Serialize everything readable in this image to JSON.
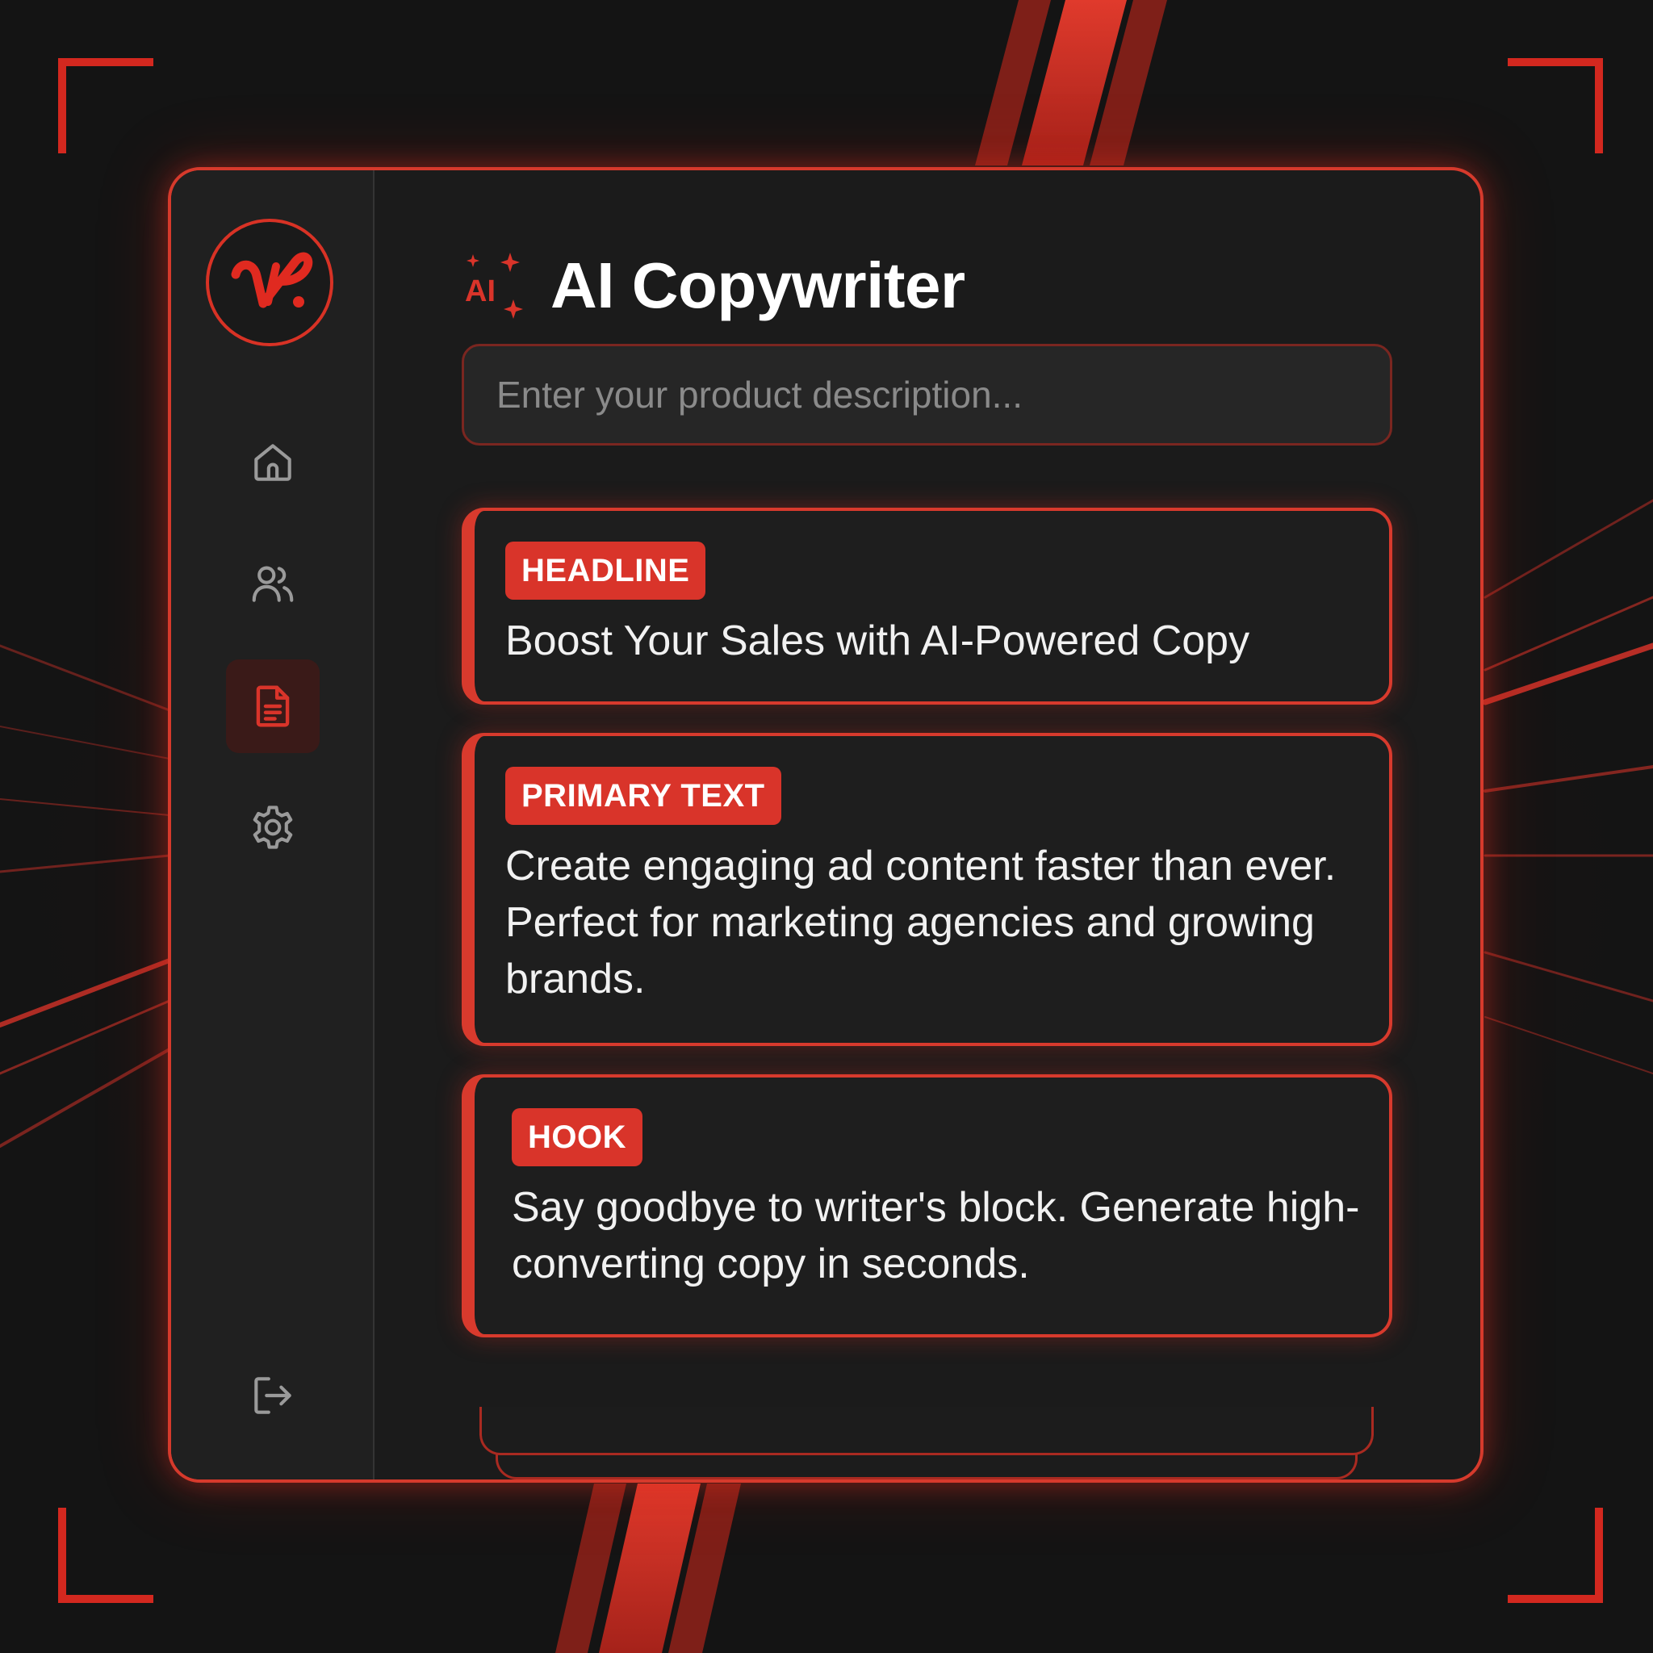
{
  "app": {
    "title": "AI Copywriter",
    "title_icon": "ai-sparkle-icon",
    "title_icon_label": "AI",
    "logo_icon": "vp-logo",
    "logo_text": "VP",
    "accent_color": "#d9342a"
  },
  "sidebar": {
    "items": [
      {
        "icon": "home-icon",
        "active": false
      },
      {
        "icon": "users-icon",
        "active": false
      },
      {
        "icon": "document-icon",
        "active": true
      },
      {
        "icon": "gear-icon",
        "active": false
      }
    ],
    "footer_icon": "logout-icon"
  },
  "search": {
    "placeholder": "Enter your product description..."
  },
  "cards": [
    {
      "label": "HEADLINE",
      "text": "Boost Your Sales with AI-Powered Copy"
    },
    {
      "label": "PRIMARY TEXT",
      "text": "Create engaging ad content faster than ever. Perfect for marketing agencies and growing brands."
    },
    {
      "label": "HOOK",
      "text": "Say goodbye to writer's block. Generate high-converting copy in seconds."
    }
  ]
}
